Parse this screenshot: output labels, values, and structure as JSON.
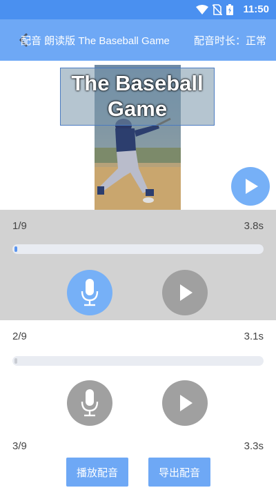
{
  "status_bar": {
    "time": "11:50"
  },
  "app_bar": {
    "title": "配音 朗读版 The Baseball Game",
    "duration_label": "配音时长：正常"
  },
  "cover": {
    "title_line1": "The Baseball",
    "title_line2": "Game"
  },
  "segments": [
    {
      "index": "1/9",
      "duration": "3.8s",
      "progress": 0.01,
      "active": true
    },
    {
      "index": "2/9",
      "duration": "3.1s",
      "progress": 0.01,
      "active": false
    },
    {
      "index": "3/9",
      "duration": "3.3s"
    }
  ],
  "bottom": {
    "play_dub_label": "播放配音",
    "export_dub_label": "导出配音"
  },
  "colors": {
    "status_bar": "#4a90f0",
    "app_bar": "#6ea8f5",
    "accent": "#76b0f7",
    "inactive_button": "#a0a0a0",
    "active_segment_bg": "#d2d2d2"
  },
  "icons": [
    "wifi-icon",
    "no-sim-icon",
    "battery-icon",
    "back-arrow-icon",
    "play-icon",
    "mic-icon"
  ]
}
